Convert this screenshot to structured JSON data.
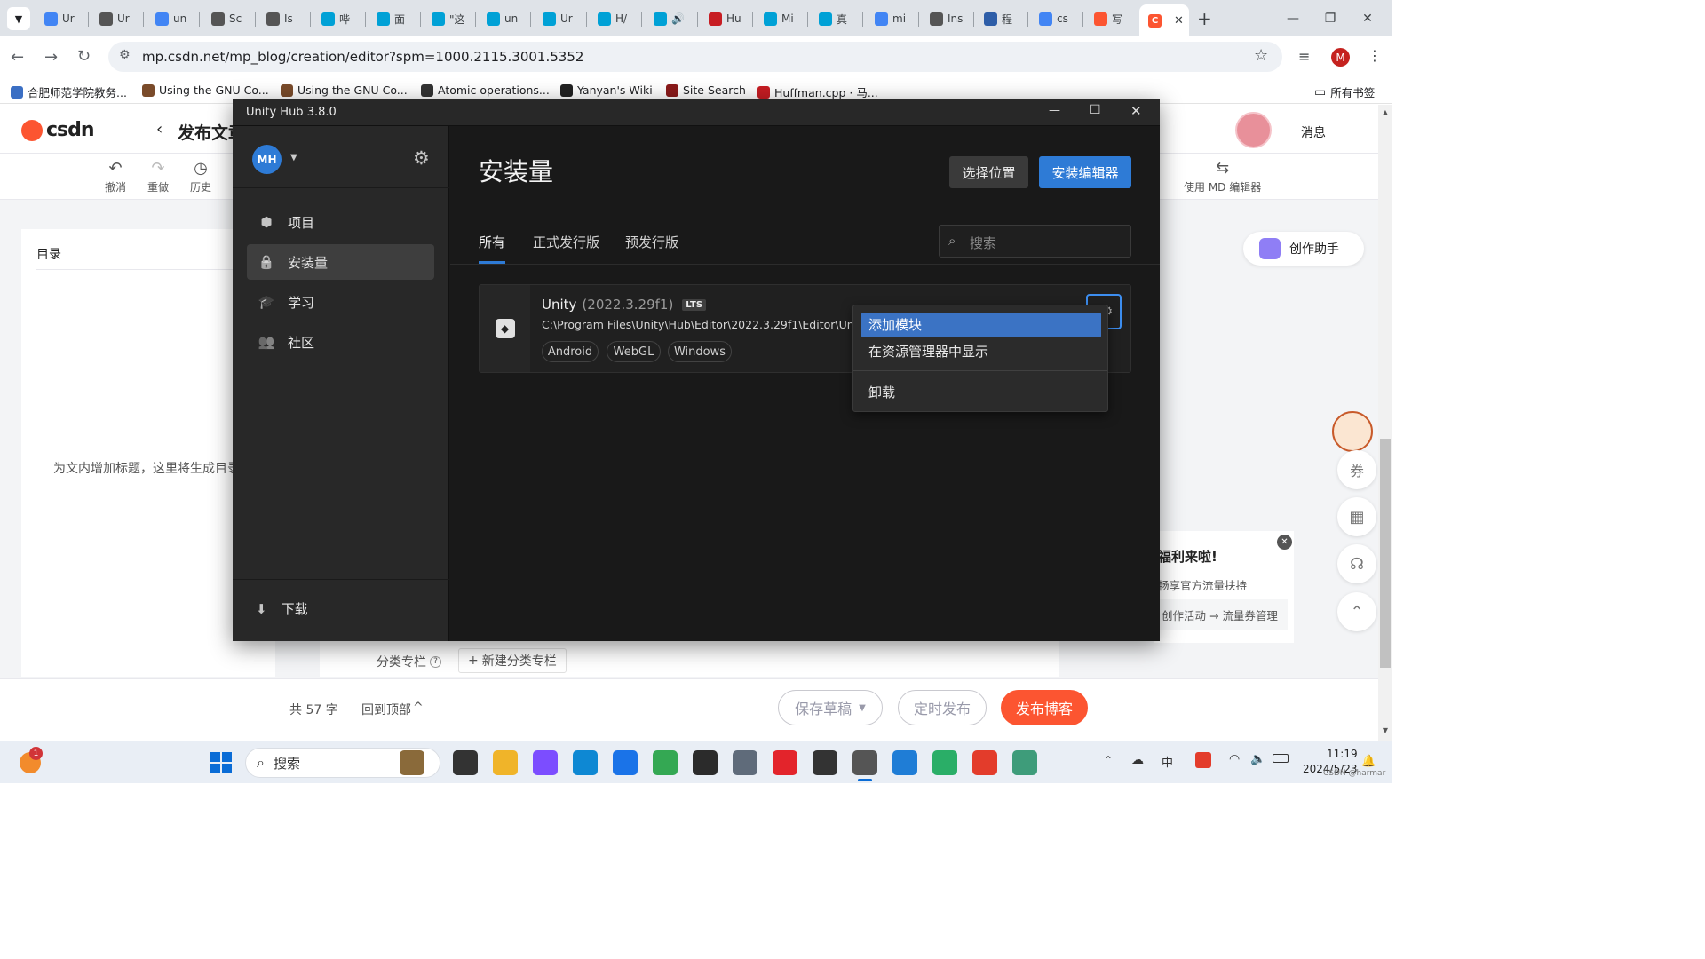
{
  "browser": {
    "tabs": [
      {
        "label": "Ur",
        "icon": "google-icon",
        "color": "#4285f4"
      },
      {
        "label": "Ur",
        "icon": "unity-icon",
        "color": "#555555"
      },
      {
        "label": "un",
        "icon": "google-icon",
        "color": "#4285f4"
      },
      {
        "label": "Sc",
        "icon": "unity-icon",
        "color": "#555555"
      },
      {
        "label": "Is",
        "icon": "unity-icon",
        "color": "#555555"
      },
      {
        "label": "哔",
        "icon": "bilibili-icon",
        "color": "#00a1d6"
      },
      {
        "label": "面",
        "icon": "bilibili-icon",
        "color": "#00a1d6"
      },
      {
        "label": "\"这",
        "icon": "bilibili-icon",
        "color": "#00a1d6"
      },
      {
        "label": "un",
        "icon": "bilibili-icon",
        "color": "#00a1d6"
      },
      {
        "label": "Ur",
        "icon": "bilibili-icon",
        "color": "#00a1d6"
      },
      {
        "label": "H/",
        "icon": "bilibili-icon",
        "color": "#00a1d6"
      },
      {
        "label": "🔊",
        "icon": "bilibili-icon",
        "color": "#00a1d6"
      },
      {
        "label": "Hu",
        "icon": "gitee-icon",
        "color": "#c71d23"
      },
      {
        "label": "Mi",
        "icon": "bilibili-icon",
        "color": "#00a1d6"
      },
      {
        "label": "真",
        "icon": "bilibili-icon",
        "color": "#00a1d6"
      },
      {
        "label": "mi",
        "icon": "google-icon",
        "color": "#4285f4"
      },
      {
        "label": "Ins",
        "icon": "unity-icon",
        "color": "#555555"
      },
      {
        "label": "程",
        "icon": "blog-icon",
        "color": "#2e5ea8"
      },
      {
        "label": "cs",
        "icon": "google-icon",
        "color": "#4285f4"
      },
      {
        "label": "写",
        "icon": "csdn-icon",
        "color": "#fc5531"
      }
    ],
    "active_tab_icon": "csdn-icon",
    "url": "mp.csdn.net/mp_blog/creation/editor?spm=1000.2115.3001.5352",
    "profile_initial": "M",
    "bookmarks": [
      {
        "label": "合肥师范学院教务...",
        "color": "#3b6fc4"
      },
      {
        "label": "Using the GNU Co...",
        "color": "#7a4b2a"
      },
      {
        "label": "Using the GNU Co...",
        "color": "#7a4b2a"
      },
      {
        "label": "Atomic operations...",
        "color": "#333333"
      },
      {
        "label": "Yanyan's Wiki",
        "color": "#222222"
      },
      {
        "label": "Site Search",
        "color": "#8b1a1a"
      },
      {
        "label": "Huffman.cpp · 马...",
        "color": "#c71d23"
      }
    ],
    "all_bookmarks": "所有书签"
  },
  "csdn": {
    "logo": "csdn",
    "back_title": "发布文章",
    "messages": "消息",
    "toolbar": {
      "undo": "撤消",
      "redo": "重做",
      "history": "历史",
      "md_editor": "使用 MD 编辑器"
    },
    "toc_title": "目录",
    "toc_hint": "为文内增加标题，这里将生成目录",
    "assistant": "创作助手",
    "promo": {
      "title": "福利来啦!",
      "subtitle": "畅享官方流量扶持",
      "link": "创作活动 → 流量券管理"
    },
    "category_label": "分类专栏",
    "new_category": "新建分类专栏",
    "word_count": "共 57 字",
    "back_to_top": "回到顶部",
    "save_draft": "保存草稿",
    "scheduled": "定时发布",
    "publish": "发布博客",
    "accent": "#fc5531"
  },
  "hub": {
    "title": "Unity Hub 3.8.0",
    "avatar": "MH",
    "nav": [
      {
        "label": "项目",
        "icon": "cube-icon"
      },
      {
        "label": "安装量",
        "icon": "lock-icon"
      },
      {
        "label": "学习",
        "icon": "graduation-cap-icon"
      },
      {
        "label": "社区",
        "icon": "people-icon"
      }
    ],
    "downloads": "下载",
    "heading": "安装量",
    "locate_button": "选择位置",
    "install_button": "安装编辑器",
    "tabs": [
      "所有",
      "正式发行版",
      "预发行版"
    ],
    "search_placeholder": "搜索",
    "install": {
      "name": "Unity",
      "version": "(2022.3.29f1)",
      "badge": "LTS",
      "path": "C:\\Program Files\\Unity\\Hub\\Editor\\2022.3.29f1\\Editor\\Unity.exe",
      "modules": [
        "Android",
        "WebGL",
        "Windows"
      ]
    },
    "context_menu": [
      "添加模块",
      "在资源管理器中显示",
      "卸载"
    ],
    "accent": "#2e7bd6"
  },
  "taskbar": {
    "search": "搜索",
    "time": "11:19",
    "date": "2024/5/23",
    "notification_count": "1",
    "watermark": "CSDN @harmar"
  }
}
